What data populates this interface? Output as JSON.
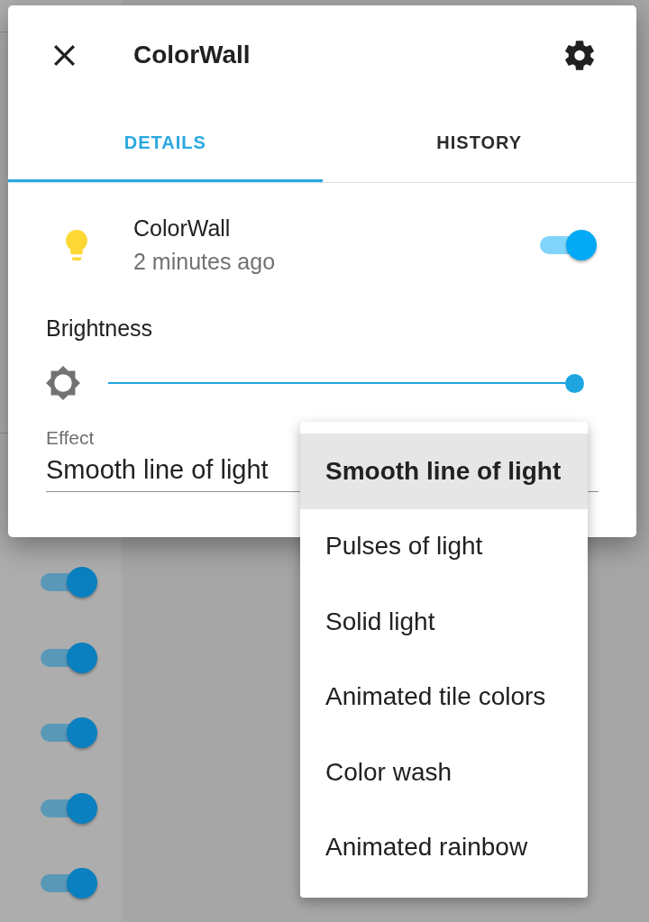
{
  "dialog": {
    "title": "ColorWall",
    "tabs": [
      {
        "label": "DETAILS",
        "selected": true
      },
      {
        "label": "HISTORY",
        "selected": false
      }
    ],
    "entity": {
      "name": "ColorWall",
      "last_changed": "2 minutes ago",
      "on": true
    },
    "brightness": {
      "label": "Brightness",
      "level": 1
    },
    "effect": {
      "label": "Effect",
      "value": "Smooth line of light"
    }
  },
  "effect_menu": {
    "options": [
      {
        "label": "Smooth line of light",
        "selected": true
      },
      {
        "label": "Pulses of light",
        "selected": false
      },
      {
        "label": "Solid light",
        "selected": false
      },
      {
        "label": "Animated tile colors",
        "selected": false
      },
      {
        "label": "Color wash",
        "selected": false
      },
      {
        "label": "Animated rainbow",
        "selected": false
      }
    ]
  },
  "background": {
    "toggles": [
      {
        "on": true
      },
      {
        "on": true
      },
      {
        "on": true
      },
      {
        "on": true
      },
      {
        "on": true
      }
    ]
  }
}
